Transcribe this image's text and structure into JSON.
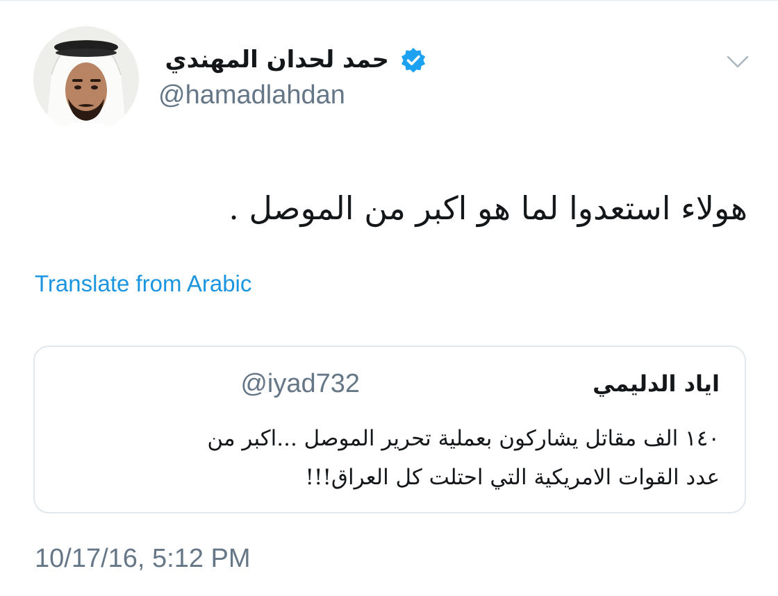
{
  "tweet": {
    "author": {
      "display_name": "حمد لحدان المهندي",
      "handle": "@hamadlahdan",
      "verified": true,
      "avatar_icon": "user-avatar"
    },
    "menu_icon": "chevron-down-icon",
    "text": "هولاء استعدوا لما هو اكبر من الموصل .",
    "translate_label": "Translate from Arabic",
    "quoted_tweet": {
      "author_name": "اياد الدليمي",
      "author_handle": "@iyad732",
      "text_lines": [
        "١٤٠ الف مقاتل يشاركون بعملية تحرير الموصل ...اكبر من",
        "عدد القوات الامريكية التي احتلت كل العراق!!!"
      ]
    },
    "timestamp": "10/17/16, 5:12 PM"
  },
  "colors": {
    "link": "#1b95e0",
    "verified": "#1da1f2",
    "secondary_text": "#657786",
    "border": "#e1e8ed",
    "primary_text": "#14171a"
  }
}
